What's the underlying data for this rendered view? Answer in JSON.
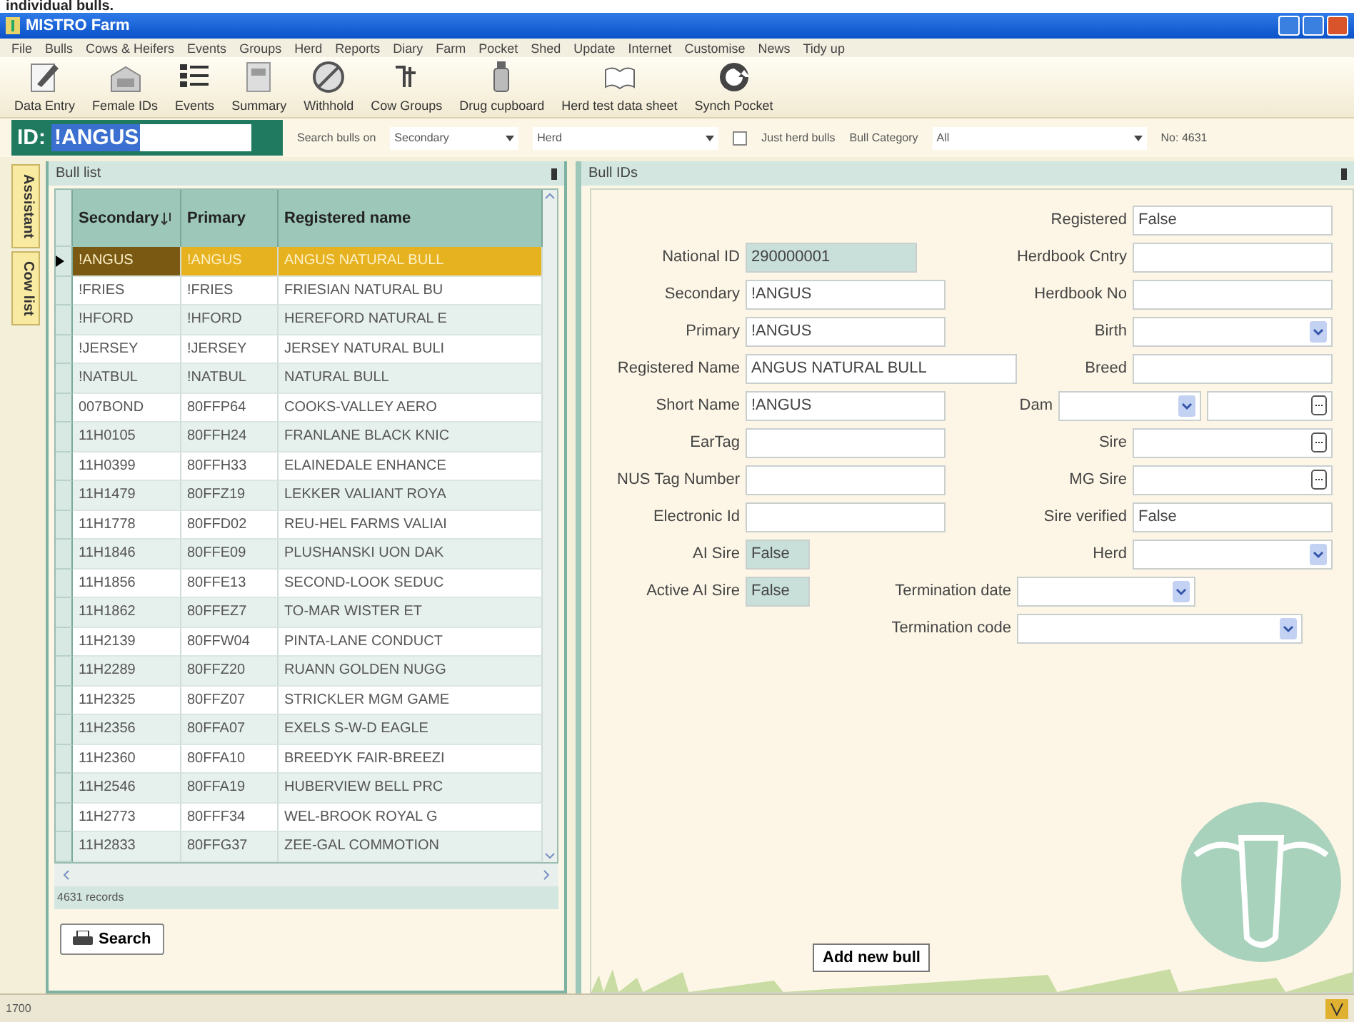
{
  "caption": "individual bulls.",
  "window": {
    "title": "MISTRO Farm"
  },
  "menu": [
    "File",
    "Bulls",
    "Cows & Heifers",
    "Events",
    "Groups",
    "Herd",
    "Reports",
    "Diary",
    "Farm",
    "Pocket",
    "Shed",
    "Update",
    "Internet",
    "Customise",
    "News",
    "Tidy up"
  ],
  "toolbar": [
    {
      "label": "Data Entry",
      "kind": "pencil"
    },
    {
      "label": "Female IDs",
      "kind": "barn"
    },
    {
      "label": "Events",
      "kind": "list"
    },
    {
      "label": "Summary",
      "kind": "doc"
    },
    {
      "label": "Withhold",
      "kind": "ban"
    },
    {
      "label": "Cow Groups",
      "kind": "groups"
    },
    {
      "label": "Drug cupboard",
      "kind": "bottle"
    },
    {
      "label": "Herd test data sheet",
      "kind": "book"
    },
    {
      "label": "Synch Pocket",
      "kind": "sync"
    }
  ],
  "id_bar": {
    "label": "ID:",
    "value": "!ANGUS",
    "search_label": "Search bulls on",
    "search_value": "Secondary",
    "herd_label": "Herd",
    "just_herd": {
      "label": "Just herd bulls",
      "checked": false
    },
    "category_label": "Bull Category",
    "category_value": "All",
    "count": "No: 4631"
  },
  "side_tabs": [
    "Assistant",
    "Cow list"
  ],
  "bull_list": {
    "title": "Bull list",
    "columns": [
      "Secondary",
      "Primary",
      "Registered name"
    ],
    "rows": [
      {
        "cells": [
          "!ANGUS",
          "!ANGUS",
          "ANGUS NATURAL BULL"
        ],
        "selected": true
      },
      {
        "cells": [
          "!FRIES",
          "!FRIES",
          "FRIESIAN NATURAL BU"
        ],
        "selected": false
      },
      {
        "cells": [
          "!HFORD",
          "!HFORD",
          "HEREFORD NATURAL E"
        ],
        "selected": false
      },
      {
        "cells": [
          "!JERSEY",
          "!JERSEY",
          "JERSEY NATURAL BULI"
        ],
        "selected": false
      },
      {
        "cells": [
          "!NATBUL",
          "!NATBUL",
          "NATURAL BULL"
        ],
        "selected": false
      },
      {
        "cells": [
          "007BOND",
          "80FFP64",
          "COOKS-VALLEY AERO"
        ],
        "selected": false
      },
      {
        "cells": [
          "11H0105",
          "80FFH24",
          "FRANLANE BLACK KNIC"
        ],
        "selected": false
      },
      {
        "cells": [
          "11H0399",
          "80FFH33",
          "ELAINEDALE ENHANCE"
        ],
        "selected": false
      },
      {
        "cells": [
          "11H1479",
          "80FFZ19",
          "LEKKER VALIANT ROYA"
        ],
        "selected": false
      },
      {
        "cells": [
          "11H1778",
          "80FFD02",
          "REU-HEL FARMS VALIAI"
        ],
        "selected": false
      },
      {
        "cells": [
          "11H1846",
          "80FFE09",
          "PLUSHANSKI UON DAK"
        ],
        "selected": false
      },
      {
        "cells": [
          "11H1856",
          "80FFE13",
          "SECOND-LOOK SEDUC"
        ],
        "selected": false
      },
      {
        "cells": [
          "11H1862",
          "80FFEZ7",
          "TO-MAR WISTER ET"
        ],
        "selected": false
      },
      {
        "cells": [
          "11H2139",
          "80FFW04",
          "PINTA-LANE CONDUCT"
        ],
        "selected": false
      },
      {
        "cells": [
          "11H2289",
          "80FFZ20",
          "RUANN GOLDEN NUGG"
        ],
        "selected": false
      },
      {
        "cells": [
          "11H2325",
          "80FFZ07",
          "STRICKLER MGM GAME"
        ],
        "selected": false
      },
      {
        "cells": [
          "11H2356",
          "80FFA07",
          "EXELS S-W-D EAGLE"
        ],
        "selected": false
      },
      {
        "cells": [
          "11H2360",
          "80FFA10",
          "BREEDYK FAIR-BREEZI"
        ],
        "selected": false
      },
      {
        "cells": [
          "11H2546",
          "80FFA19",
          "HUBERVIEW BELL PRC"
        ],
        "selected": false
      },
      {
        "cells": [
          "11H2773",
          "80FFF34",
          "WEL-BROOK ROYAL G"
        ],
        "selected": false
      },
      {
        "cells": [
          "11H2833",
          "80FFG37",
          "ZEE-GAL COMMOTION"
        ],
        "selected": false
      }
    ],
    "records": "4631 records",
    "search_button": "Search"
  },
  "bull_ids": {
    "title": "Bull IDs",
    "rows": [
      {
        "left": null,
        "right": {
          "label": "Registered",
          "value": "False",
          "kind": "text"
        }
      },
      {
        "left": {
          "label": "National ID",
          "value": "290000001",
          "kind": "readonly"
        },
        "right": {
          "label": "Herdbook Cntry",
          "kind": "text"
        }
      },
      {
        "left": {
          "label": "Secondary",
          "value": "!ANGUS",
          "kind": "text"
        },
        "right": {
          "label": "Herdbook No",
          "kind": "text"
        }
      },
      {
        "left": {
          "label": "Primary",
          "value": "!ANGUS",
          "kind": "text"
        },
        "right": {
          "label": "Birth",
          "kind": "dropdown"
        }
      },
      {
        "left": {
          "label": "Registered Name",
          "value": "ANGUS NATURAL BULL",
          "kind": "wide"
        },
        "right": {
          "label": "Breed",
          "kind": "text"
        }
      },
      {
        "left": {
          "label": "Short Name",
          "value": "!ANGUS",
          "kind": "text"
        },
        "right": {
          "label": "Dam",
          "kind": "combo"
        }
      },
      {
        "left": {
          "label": "EarTag",
          "kind": "text"
        },
        "right": {
          "label": "Sire",
          "kind": "lookup"
        }
      },
      {
        "left": {
          "label": "NUS Tag Number",
          "kind": "text"
        },
        "right": {
          "label": "MG Sire",
          "kind": "lookup"
        }
      },
      {
        "left": {
          "label": "Electronic Id",
          "kind": "text"
        },
        "right": {
          "label": "Sire verified",
          "value": "False",
          "kind": "text"
        }
      },
      {
        "left": {
          "label": "AI Sire",
          "value": "False",
          "kind": "flag"
        },
        "right": {
          "label": "Herd",
          "kind": "dropdown"
        }
      },
      {
        "left": {
          "label": "Active AI Sire",
          "value": "False",
          "kind": "flag"
        },
        "right": {
          "label": "Termination date",
          "kind": "term"
        }
      },
      {
        "left": null,
        "right": {
          "label": "Termination code",
          "kind": "termwide"
        }
      }
    ],
    "add_button": "Add new bull"
  },
  "status_bar": {
    "text": "1700"
  }
}
